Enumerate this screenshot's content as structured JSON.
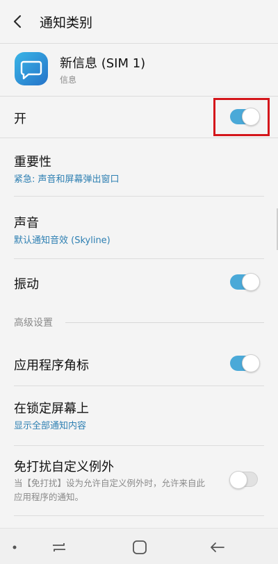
{
  "header": {
    "title": "通知类别"
  },
  "app": {
    "name": "新信息 (SIM 1)",
    "sub": "信息"
  },
  "main_toggle": {
    "label": "开",
    "on": true
  },
  "importance": {
    "title": "重要性",
    "value": "紧急: 声音和屏幕弹出窗口"
  },
  "sound": {
    "title": "声音",
    "value": "默认通知音效 (Skyline)"
  },
  "vibrate": {
    "label": "振动",
    "on": true
  },
  "advanced": {
    "section_label": "高级设置"
  },
  "badge": {
    "label": "应用程序角标",
    "on": true
  },
  "lock_screen": {
    "title": "在锁定屏幕上",
    "value": "显示全部通知内容"
  },
  "dnd": {
    "title": "免打扰自定义例外",
    "desc": "当【免打扰】设为允许自定义例外时，允许来自此应用程序的通知。",
    "on": false
  },
  "colors": {
    "accent": "#4aa9d8",
    "link": "#2d7fb2",
    "highlight": "#d4161b"
  }
}
